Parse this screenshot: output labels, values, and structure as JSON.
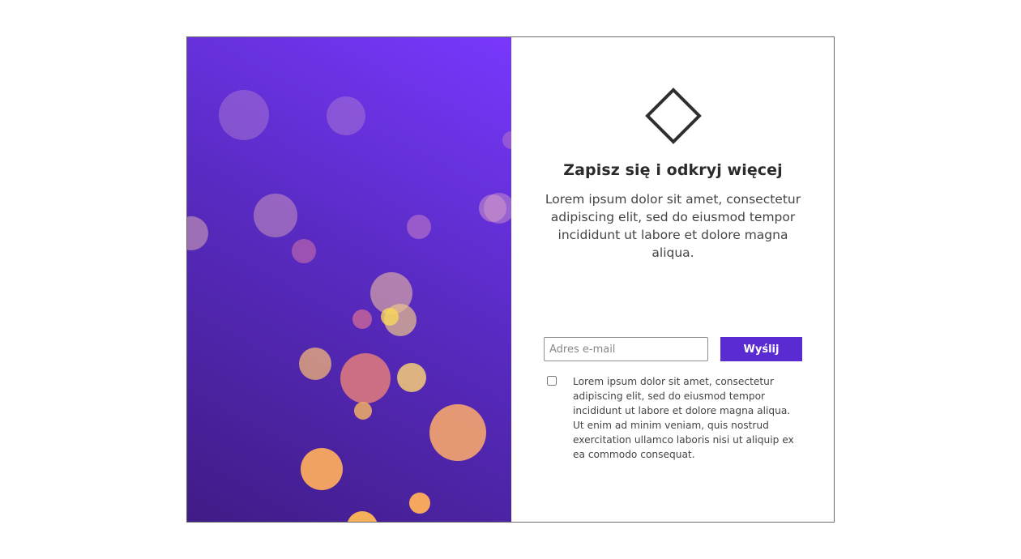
{
  "signup": {
    "logo_icon": "diamond-outline-icon",
    "title": "Zapisz się i odkryj więcej",
    "description": "Lorem ipsum dolor sit amet, consectetur adipiscing elit, sed do eiusmod tempor incididunt ut labore et dolore magna aliqua.",
    "email_placeholder": "Adres e-mail",
    "email_value": "",
    "submit_label": "Wyślij",
    "consent_checked": false,
    "consent_text": "Lorem ipsum dolor sit amet, consectetur adipiscing elit, sed do eiusmod tempor incididunt ut labore et dolore magna aliqua. Ut enim ad minim veniam, quis nostrud exercitation ullamco laboris nisi ut aliquip ex ea commodo consequat."
  },
  "colors": {
    "gradient_dark": "#3f1c86",
    "gradient_light": "#7838fd",
    "button": "#5a2bd0",
    "title": "#2b2b2b",
    "body_text": "#444444"
  }
}
